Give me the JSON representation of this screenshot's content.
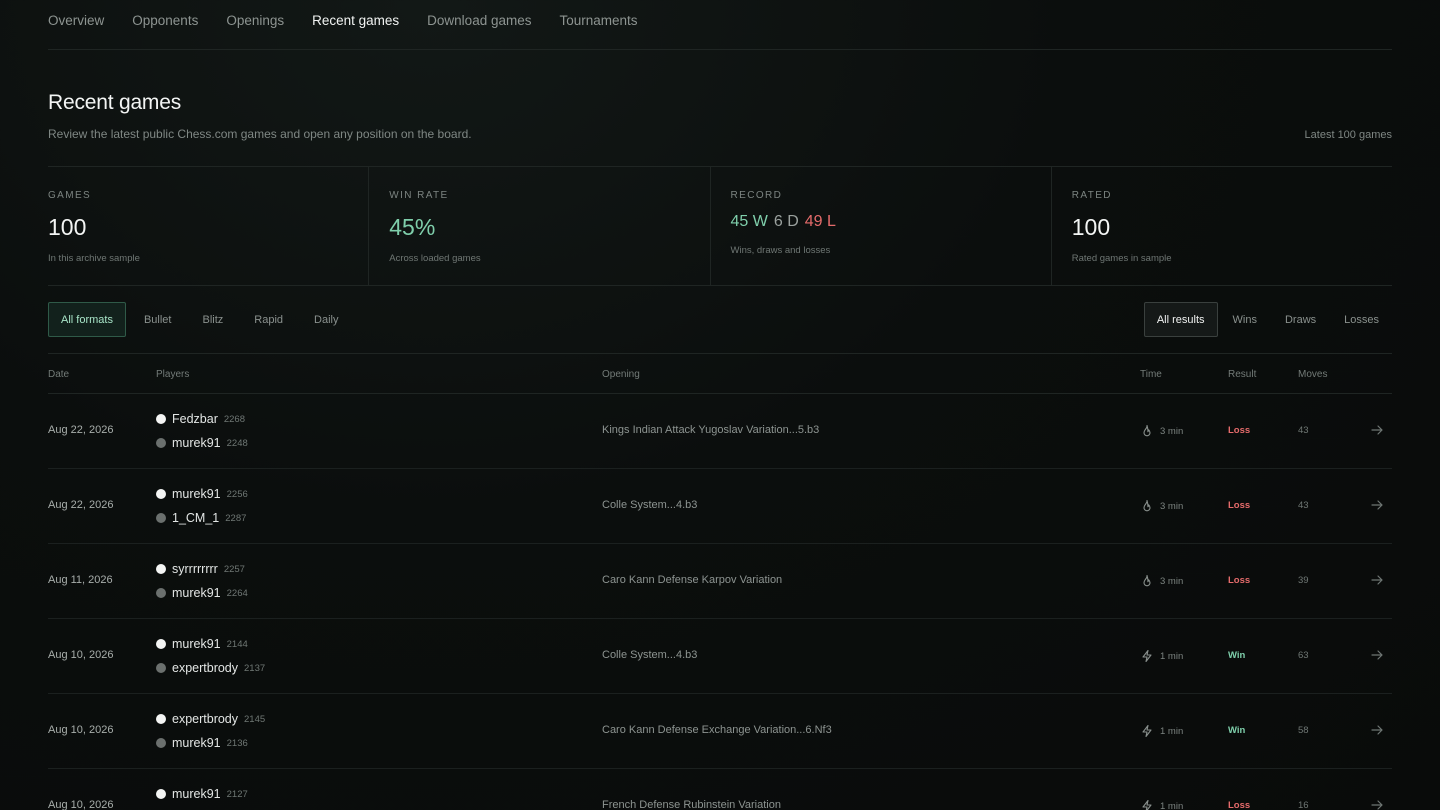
{
  "nav": [
    "Overview",
    "Opponents",
    "Openings",
    "Recent games",
    "Download games",
    "Tournaments"
  ],
  "nav_active": 3,
  "header": {
    "title": "Recent games",
    "subtitle": "Review the latest public Chess.com games and open any position on the board.",
    "latest": "Latest 100 games"
  },
  "stats": {
    "games": {
      "label": "GAMES",
      "value": "100",
      "note": "In this archive sample"
    },
    "winrate": {
      "label": "WIN RATE",
      "value": "45%",
      "note": "Across loaded games"
    },
    "record": {
      "label": "RECORD",
      "w": "45 W",
      "d": "6 D",
      "l": "49 L",
      "note": "Wins, draws and losses"
    },
    "rated": {
      "label": "RATED",
      "value": "100",
      "note": "Rated games in sample"
    }
  },
  "filters": {
    "formats": [
      "All formats",
      "Bullet",
      "Blitz",
      "Rapid",
      "Daily"
    ],
    "results": [
      "All results",
      "Wins",
      "Draws",
      "Losses"
    ]
  },
  "table": {
    "headers": {
      "date": "Date",
      "players": "Players",
      "opening": "Opening",
      "time": "Time",
      "result": "Result",
      "moves": "Moves"
    },
    "rows": [
      {
        "date": "Aug 22, 2026",
        "white": "Fedzbar",
        "white_rating": "2268",
        "black": "murek91",
        "black_rating": "2248",
        "opening": "Kings Indian Attack Yugoslav Variation...5.b3",
        "time_icon": "flame-icon",
        "time": "3 min",
        "result": "Loss",
        "moves": "43"
      },
      {
        "date": "Aug 22, 2026",
        "white": "murek91",
        "white_rating": "2256",
        "black": "1_CM_1",
        "black_rating": "2287",
        "opening": "Colle System...4.b3",
        "time_icon": "flame-icon",
        "time": "3 min",
        "result": "Loss",
        "moves": "43"
      },
      {
        "date": "Aug 11, 2026",
        "white": "syrrrrrrrr",
        "white_rating": "2257",
        "black": "murek91",
        "black_rating": "2264",
        "opening": "Caro Kann Defense Karpov Variation",
        "time_icon": "flame-icon",
        "time": "3 min",
        "result": "Loss",
        "moves": "39"
      },
      {
        "date": "Aug 10, 2026",
        "white": "murek91",
        "white_rating": "2144",
        "black": "expertbrody",
        "black_rating": "2137",
        "opening": "Colle System...4.b3",
        "time_icon": "bolt-icon",
        "time": "1 min",
        "result": "Win",
        "moves": "63"
      },
      {
        "date": "Aug 10, 2026",
        "white": "expertbrody",
        "white_rating": "2145",
        "black": "murek91",
        "black_rating": "2136",
        "opening": "Caro Kann Defense Exchange Variation...6.Nf3",
        "time_icon": "bolt-icon",
        "time": "1 min",
        "result": "Win",
        "moves": "58"
      },
      {
        "date": "Aug 10, 2026",
        "white": "murek91",
        "white_rating": "2127",
        "black": "",
        "black_rating": "",
        "opening": "French Defense Rubinstein Variation",
        "time_icon": "bolt-icon",
        "time": "1 min",
        "result": "Loss",
        "moves": "16"
      }
    ]
  },
  "colors": {
    "win": "#7fcfab",
    "loss": "#e56b6b",
    "draw": "#9aa19e",
    "accent": "#2f5a48"
  }
}
